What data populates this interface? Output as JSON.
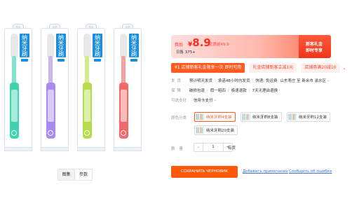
{
  "gallery": {
    "packs": [
      {
        "label": "纳米牙刷",
        "handle_color": "#3fd3b0",
        "neck_color": "#7fe4cf"
      },
      {
        "label": "纳米牙刷",
        "handle_color": "#a78bf0",
        "neck_color": "#c9b6f7"
      },
      {
        "label": "纳米牙刷",
        "handle_color": "#b7dc4a",
        "neck_color": "#d4ec8c"
      },
      {
        "label": "纳米牙刷",
        "handle_color": "#f06a6a",
        "neck_color": "#f6a0a0"
      }
    ],
    "tabs": [
      {
        "label": "图集"
      },
      {
        "label": "参数"
      }
    ]
  },
  "price": {
    "coupon_tag": "券后",
    "currency": "¥",
    "amount": "8.9",
    "old_price": "优惠前¥9.9",
    "sold": "日售 375+",
    "promo_line1": "新客礼金",
    "promo_line2": "即时专享"
  },
  "coupons": {
    "main": "¥1 店铺新客礼金限享一次 即时可用",
    "chip1": "礼金店铺新客立减1元",
    "chip2": "店铺券满20减10",
    "more": "⌄"
  },
  "shipping": {
    "label": "发货",
    "time": "预计明天发货",
    "promise": "承诺48小时内发货",
    "express": "快递: 免运费",
    "route": "山东枣庄 至 新余市 渝水区"
  },
  "guarantee": {
    "label": "保障",
    "items": [
      "破损包退",
      "假一赔四",
      "极速退款",
      "7天无理由退换"
    ]
  },
  "payment": {
    "label": "可选支付",
    "value": "信用卡支付"
  },
  "sku": {
    "label": "颜色分类",
    "options": [
      {
        "label": "纳米牙刷4支装",
        "selected": true
      },
      {
        "label": "纳米牙刷8支装",
        "selected": false
      },
      {
        "label": "纳米牙刷12支装",
        "selected": false
      },
      {
        "label": "纳米牙刷20支装",
        "selected": false
      }
    ]
  },
  "quantity": {
    "label": "数量",
    "minus": "-",
    "value": "1",
    "plus": "+",
    "stock": "有货"
  },
  "actions": {
    "save": "СОХРАНИТЬ ЧЕРНОВИК",
    "add_note": "Добавить примечание",
    "report_error": "Сообщить об ошибке"
  }
}
